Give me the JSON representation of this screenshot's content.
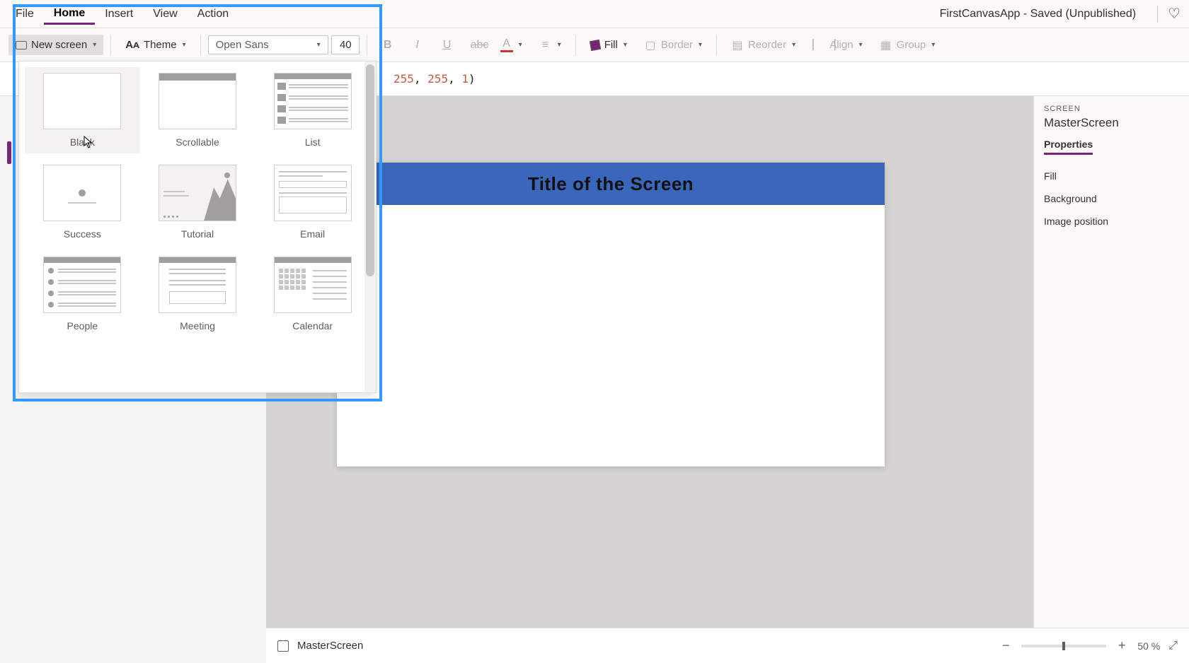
{
  "app": {
    "title": "FirstCanvasApp - Saved (Unpublished)"
  },
  "menubar": {
    "items": [
      "File",
      "Home",
      "Insert",
      "View",
      "Action"
    ],
    "active_index": 1
  },
  "ribbon": {
    "new_screen": "New screen",
    "theme": "Theme",
    "font_name": "Open Sans",
    "font_size": "40",
    "fill": "Fill",
    "border": "Border",
    "reorder": "Reorder",
    "align": "Align",
    "group": "Group"
  },
  "formula": {
    "literal_a": "255",
    "literal_b": "255",
    "literal_c": "1"
  },
  "templates": [
    {
      "name": "Blank",
      "kind": "blank"
    },
    {
      "name": "Scrollable",
      "kind": "scroll"
    },
    {
      "name": "List",
      "kind": "list"
    },
    {
      "name": "Success",
      "kind": "success"
    },
    {
      "name": "Tutorial",
      "kind": "tutorial"
    },
    {
      "name": "Email",
      "kind": "email"
    },
    {
      "name": "People",
      "kind": "people"
    },
    {
      "name": "Meeting",
      "kind": "meeting"
    },
    {
      "name": "Calendar",
      "kind": "calendar"
    }
  ],
  "canvas": {
    "screen_title": "Title of the Screen"
  },
  "properties": {
    "section": "SCREEN",
    "object_name": "MasterScreen",
    "tab": "Properties",
    "rows": [
      "Fill",
      "Background",
      "Image position"
    ]
  },
  "status": {
    "screen_name": "MasterScreen",
    "zoom": "50",
    "zoom_suffix": "%"
  }
}
